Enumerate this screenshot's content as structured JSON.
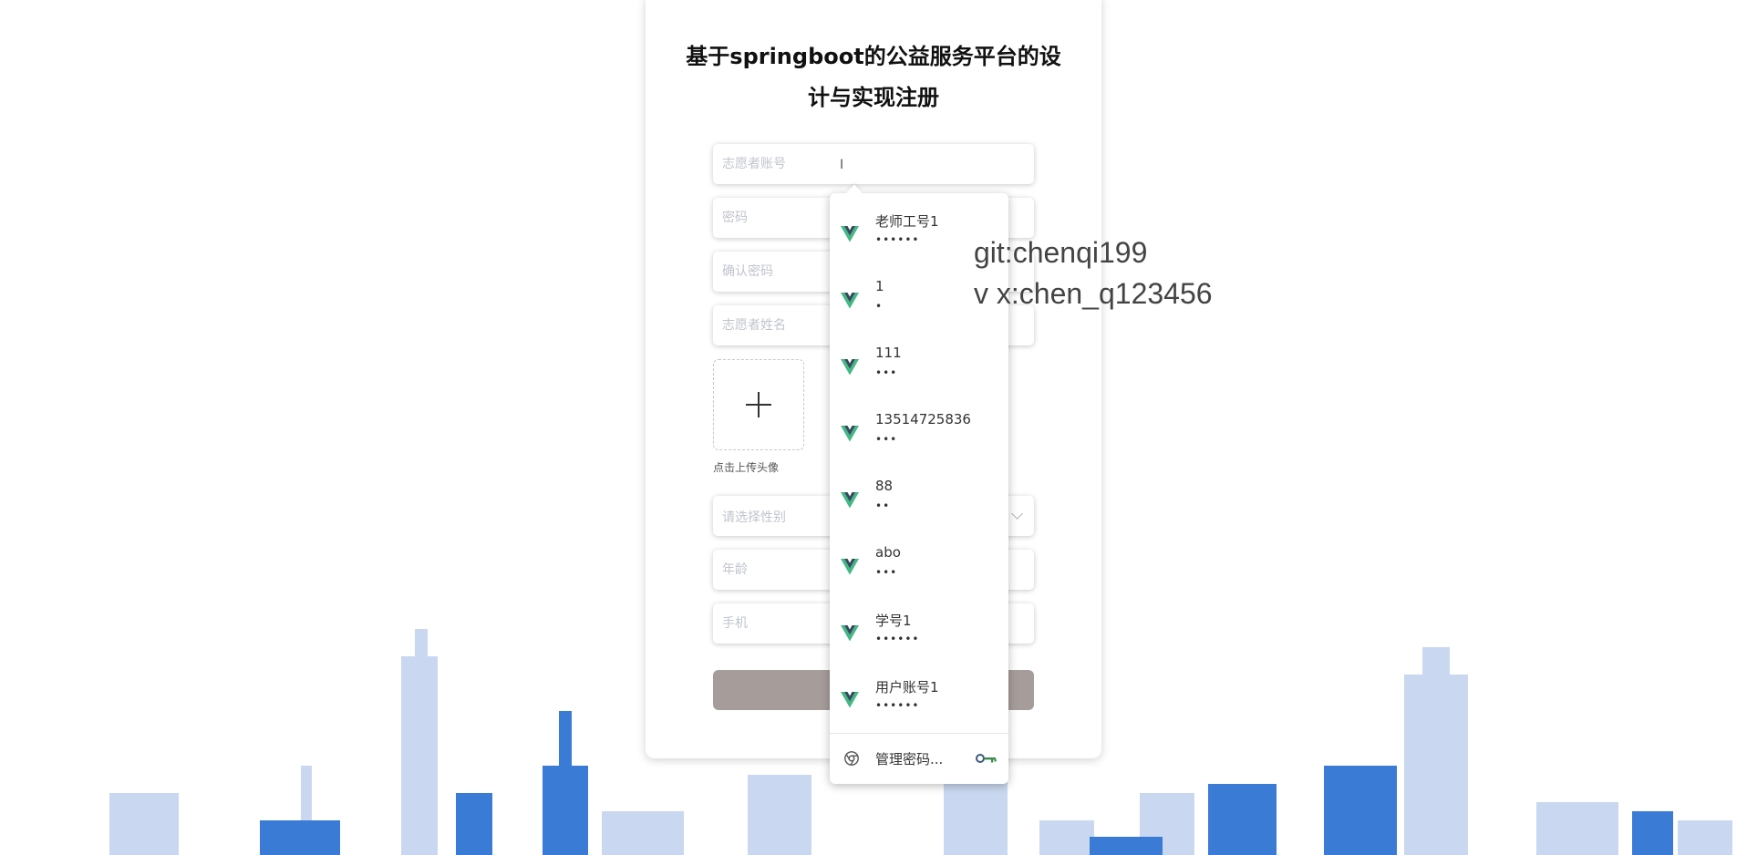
{
  "page": {
    "title": "基于springboot的公益服务平台的设计与实现注册"
  },
  "form": {
    "account_placeholder": "志愿者账号",
    "password_placeholder": "密码",
    "confirm_password_placeholder": "确认密码",
    "name_placeholder": "志愿者姓名",
    "upload_label": "点击上传头像",
    "gender_placeholder": "请选择性别",
    "age_placeholder": "年龄",
    "phone_placeholder": "手机",
    "submit_label": ""
  },
  "autofill": {
    "suggestions": [
      {
        "username": "老师工号1",
        "password": "••••••"
      },
      {
        "username": "1",
        "password": "•"
      },
      {
        "username": "111",
        "password": "•••"
      },
      {
        "username": "13514725836",
        "password": "•••"
      },
      {
        "username": "88",
        "password": "••"
      },
      {
        "username": "abo",
        "password": "•••"
      },
      {
        "username": "学号1",
        "password": "••••••"
      },
      {
        "username": "用户账号1",
        "password": "••••••"
      }
    ],
    "manage_label": "管理密码..."
  },
  "overlay": {
    "line1": "git:chenqi199",
    "line2": "v x:chen_q123456"
  },
  "colors": {
    "submit_bg": "#a69d9a",
    "vue_green": "#42b883",
    "vue_dark": "#35495e",
    "skyline_blue": "#3a7bd5",
    "skyline_light": "#c9d8f0"
  }
}
